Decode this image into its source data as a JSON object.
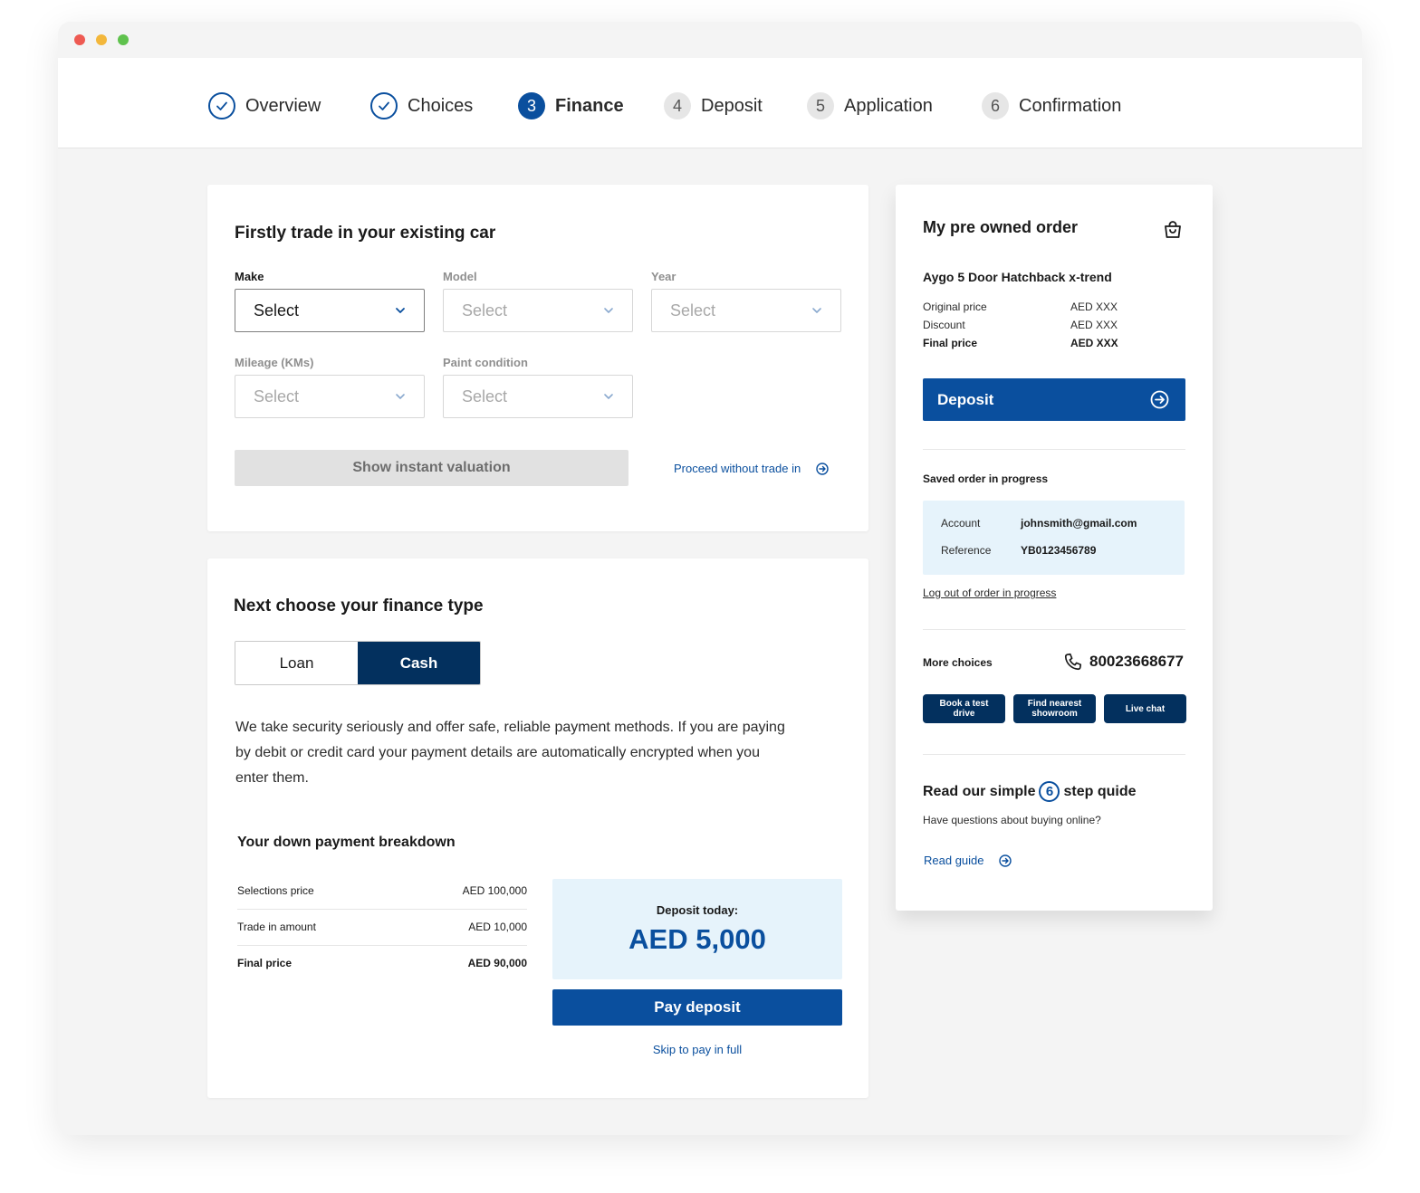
{
  "stepper": {
    "steps": [
      {
        "num": "",
        "label": "Overview",
        "state": "done"
      },
      {
        "num": "",
        "label": "Choices",
        "state": "done"
      },
      {
        "num": "3",
        "label": "Finance",
        "state": "active"
      },
      {
        "num": "4",
        "label": "Deposit",
        "state": "todo"
      },
      {
        "num": "5",
        "label": "Application",
        "state": "todo"
      },
      {
        "num": "6",
        "label": "Confirmation",
        "state": "todo"
      }
    ]
  },
  "trade_in": {
    "title": "Firstly trade in your existing car",
    "fields": {
      "make": {
        "label": "Make",
        "value": "Select"
      },
      "model": {
        "label": "Model",
        "value": "Select"
      },
      "year": {
        "label": "Year",
        "value": "Select"
      },
      "mileage": {
        "label": "Mileage (KMs)",
        "value": "Select"
      },
      "paint": {
        "label": "Paint condition",
        "value": "Select"
      }
    },
    "valuation_button": "Show instant valuation",
    "proceed_link": "Proceed without trade in"
  },
  "finance": {
    "title": "Next choose your finance type",
    "options": {
      "loan": "Loan",
      "cash": "Cash"
    },
    "selected": "Cash",
    "description": "We take security seriously and offer safe, reliable payment methods. If you are paying by debit or credit card your payment details are automatically encrypted when you enter them.",
    "breakdown": {
      "title": "Your down payment breakdown",
      "rows": [
        {
          "label": "Selections price",
          "value": "AED 100,000"
        },
        {
          "label": "Trade in amount",
          "value": "AED 10,000"
        },
        {
          "label": "Final price",
          "value": "AED 90,000"
        }
      ]
    },
    "deposit_label": "Deposit today:",
    "deposit_amount": "AED 5,000",
    "pay_button": "Pay deposit",
    "skip_link": "Skip to pay in full"
  },
  "order": {
    "title": "My pre owned order",
    "car": "Aygo 5 Door Hatchback x-trend",
    "prices": [
      {
        "label": "Original price",
        "value": "AED XXX"
      },
      {
        "label": "Discount",
        "value": "AED XXX"
      },
      {
        "label": "Final price",
        "value": "AED XXX"
      }
    ],
    "deposit_button": "Deposit",
    "saved_title": "Saved order in progress",
    "account_label": "Account",
    "account_value": "johnsmith@gmail.com",
    "reference_label": "Reference",
    "reference_value": "YB0123456789",
    "logout_link": "Log out of order in progress",
    "more_choices": "More choices",
    "phone": "80023668677",
    "buttons": {
      "test_drive": "Book a test drive",
      "showroom": "Find nearest showroom",
      "chat": "Live chat"
    },
    "guide_title_pre": "Read our simple",
    "guide_number": "6",
    "guide_title_post": "step quide",
    "guide_sub": "Have questions about buying online?",
    "guide_link": "Read guide"
  },
  "colors": {
    "primary": "#0a4f9e",
    "navy": "#03305e",
    "light_blue": "#e6f3fb",
    "page_bg": "#f4f4f4"
  }
}
